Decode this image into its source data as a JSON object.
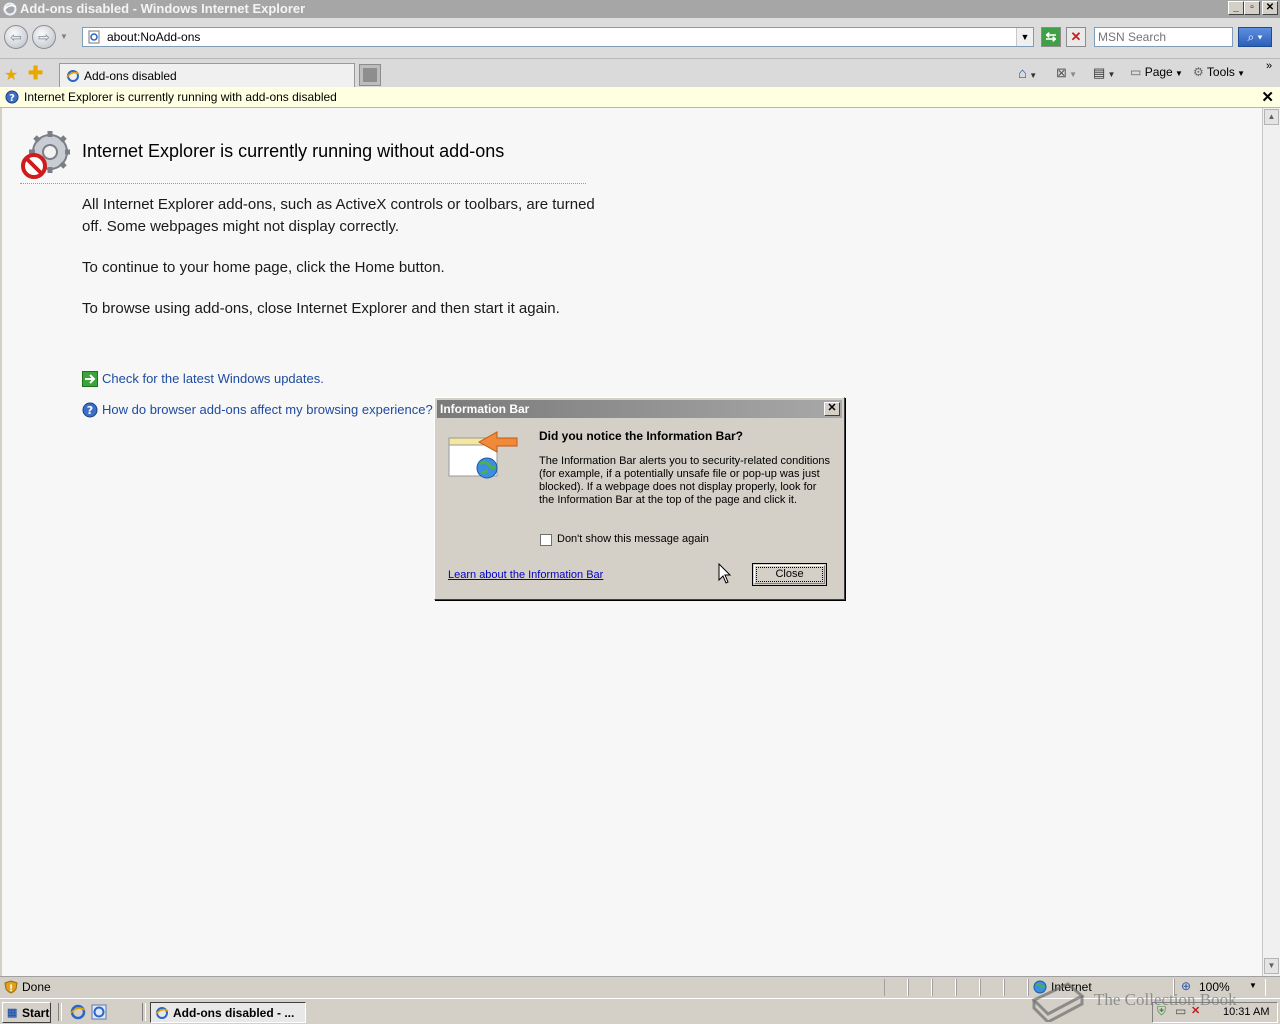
{
  "window": {
    "title": "Add-ons disabled - Windows Internet Explorer"
  },
  "address_bar": {
    "url": "about:NoAdd-ons"
  },
  "search": {
    "placeholder": "MSN Search"
  },
  "tabs": [
    {
      "label": "Add-ons disabled"
    }
  ],
  "command_bar": {
    "page_label": "Page",
    "tools_label": "Tools"
  },
  "info_bar": {
    "message": "Internet Explorer is currently running with add-ons disabled"
  },
  "content": {
    "heading": "Internet Explorer is currently running without add-ons",
    "paragraphs": [
      "All Internet Explorer add-ons, such as ActiveX controls or toolbars, are turned off. Some webpages might not display correctly.",
      "To continue to your home page, click the Home button.",
      "To browse using add-ons, close Internet Explorer and then start it again."
    ],
    "links": [
      {
        "label": "Check for the latest Windows updates."
      },
      {
        "label": "How do browser add-ons affect my browsing experience?"
      }
    ]
  },
  "dialog": {
    "title": "Information Bar",
    "heading": "Did you notice the Information Bar?",
    "body": "The Information Bar alerts you to security-related conditions (for example, if a potentially unsafe file or pop-up was just blocked). If a webpage does not display properly, look for the Information Bar at the top of the page and click it.",
    "checkbox_label": "Don't show this message again",
    "checkbox_checked": false,
    "learn_link": "Learn about the Information Bar",
    "close_label": "Close"
  },
  "status_bar": {
    "status": "Done",
    "zone": "Internet",
    "zoom": "100%"
  },
  "taskbar": {
    "start_label": "Start",
    "task_label": "Add-ons disabled - ...",
    "clock": "10:31 AM"
  },
  "watermark": "The Collection Book"
}
